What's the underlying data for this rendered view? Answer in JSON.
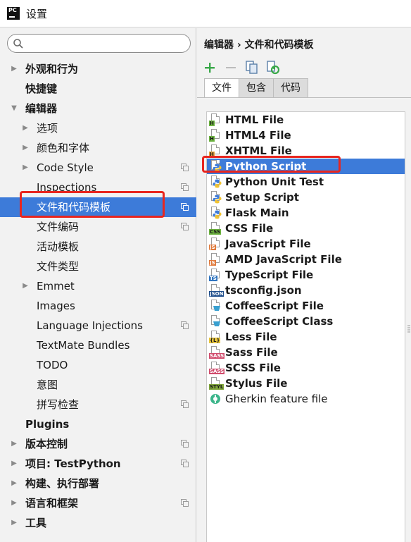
{
  "window": {
    "logo_text": "PC",
    "title": "设置"
  },
  "search": {
    "value": "",
    "placeholder": ""
  },
  "sidebar": {
    "items": [
      {
        "label": "外观和行为",
        "level": 0,
        "arrow": "▶",
        "bold": true,
        "copy": false,
        "selected": false
      },
      {
        "label": "快捷键",
        "level": 0,
        "arrow": "",
        "bold": true,
        "copy": false,
        "selected": false
      },
      {
        "label": "编辑器",
        "level": 0,
        "arrow": "▼",
        "bold": true,
        "copy": false,
        "selected": false
      },
      {
        "label": "选项",
        "level": 1,
        "arrow": "▶",
        "bold": false,
        "copy": false,
        "selected": false
      },
      {
        "label": "颜色和字体",
        "level": 1,
        "arrow": "▶",
        "bold": false,
        "copy": false,
        "selected": false
      },
      {
        "label": "Code Style",
        "level": 1,
        "arrow": "▶",
        "bold": false,
        "copy": true,
        "selected": false
      },
      {
        "label": "Inspections",
        "level": 1,
        "arrow": "",
        "bold": false,
        "copy": true,
        "selected": false
      },
      {
        "label": "文件和代码模板",
        "level": 1,
        "arrow": "",
        "bold": false,
        "copy": true,
        "selected": true
      },
      {
        "label": "文件编码",
        "level": 1,
        "arrow": "",
        "bold": false,
        "copy": true,
        "selected": false
      },
      {
        "label": "活动模板",
        "level": 1,
        "arrow": "",
        "bold": false,
        "copy": false,
        "selected": false
      },
      {
        "label": "文件类型",
        "level": 1,
        "arrow": "",
        "bold": false,
        "copy": false,
        "selected": false
      },
      {
        "label": "Emmet",
        "level": 1,
        "arrow": "▶",
        "bold": false,
        "copy": false,
        "selected": false
      },
      {
        "label": "Images",
        "level": 1,
        "arrow": "",
        "bold": false,
        "copy": false,
        "selected": false
      },
      {
        "label": "Language Injections",
        "level": 1,
        "arrow": "",
        "bold": false,
        "copy": true,
        "selected": false
      },
      {
        "label": "TextMate Bundles",
        "level": 1,
        "arrow": "",
        "bold": false,
        "copy": false,
        "selected": false
      },
      {
        "label": "TODO",
        "level": 1,
        "arrow": "",
        "bold": false,
        "copy": false,
        "selected": false
      },
      {
        "label": "意图",
        "level": 1,
        "arrow": "",
        "bold": false,
        "copy": false,
        "selected": false
      },
      {
        "label": "拼写检查",
        "level": 1,
        "arrow": "",
        "bold": false,
        "copy": true,
        "selected": false
      },
      {
        "label": "Plugins",
        "level": 0,
        "arrow": "",
        "bold": true,
        "copy": false,
        "selected": false
      },
      {
        "label": "版本控制",
        "level": 0,
        "arrow": "▶",
        "bold": true,
        "copy": true,
        "selected": false
      },
      {
        "label": "项目: TestPython",
        "level": 0,
        "arrow": "▶",
        "bold": true,
        "copy": true,
        "selected": false
      },
      {
        "label": "构建、执行部署",
        "level": 0,
        "arrow": "▶",
        "bold": true,
        "copy": false,
        "selected": false
      },
      {
        "label": "语言和框架",
        "level": 0,
        "arrow": "▶",
        "bold": true,
        "copy": true,
        "selected": false
      },
      {
        "label": "工具",
        "level": 0,
        "arrow": "▶",
        "bold": true,
        "copy": false,
        "selected": false
      }
    ]
  },
  "main": {
    "breadcrumb": "编辑器 › 文件和代码模板",
    "toolbar": [
      {
        "name": "add-icon"
      },
      {
        "name": "remove-icon"
      },
      {
        "name": "copy-template-icon"
      },
      {
        "name": "reset-icon"
      }
    ],
    "tabs": [
      {
        "label": "文件",
        "active": true
      },
      {
        "label": "包含",
        "active": false
      },
      {
        "label": "代码",
        "active": false
      }
    ],
    "templates": [
      {
        "name": "HTML File",
        "icon": "html-file-icon",
        "badge": "H",
        "badge_color": "#6cb33f",
        "bold": true,
        "selected": false
      },
      {
        "name": "HTML4 File",
        "icon": "html4-file-icon",
        "badge": "H",
        "badge_color": "#6cb33f",
        "bold": true,
        "selected": false
      },
      {
        "name": "XHTML File",
        "icon": "xhtml-file-icon",
        "badge": "H",
        "badge_color": "#e8a33d",
        "bold": true,
        "selected": false
      },
      {
        "name": "Python Script",
        "icon": "python-script-icon",
        "badge": "py",
        "badge_color": "#3d7bd9",
        "bold": true,
        "selected": true
      },
      {
        "name": "Python Unit Test",
        "icon": "python-unit-test-icon",
        "badge": "py",
        "badge_color": "#3d7bd9",
        "bold": true,
        "selected": false
      },
      {
        "name": "Setup Script",
        "icon": "setup-script-icon",
        "badge": "py",
        "badge_color": "#3d7bd9",
        "bold": true,
        "selected": false
      },
      {
        "name": "Flask Main",
        "icon": "flask-main-icon",
        "badge": "py",
        "badge_color": "#3d7bd9",
        "bold": true,
        "selected": false
      },
      {
        "name": "CSS File",
        "icon": "css-file-icon",
        "badge": "CSS",
        "badge_color": "#6cb33f",
        "bold": true,
        "selected": false
      },
      {
        "name": "JavaScript File",
        "icon": "javascript-file-icon",
        "badge": "JS",
        "badge_color": "#e07a3c",
        "bold": true,
        "selected": false
      },
      {
        "name": "AMD JavaScript File",
        "icon": "amd-javascript-file-icon",
        "badge": "JS",
        "badge_color": "#e07a3c",
        "bold": true,
        "selected": false
      },
      {
        "name": "TypeScript File",
        "icon": "typescript-file-icon",
        "badge": "TS",
        "badge_color": "#2f74c0",
        "bold": true,
        "selected": false
      },
      {
        "name": "tsconfig.json",
        "icon": "json-file-icon",
        "badge": "JSON",
        "badge_color": "#1f4e8c",
        "bold": true,
        "selected": false
      },
      {
        "name": "CoffeeScript File",
        "icon": "coffeescript-file-icon",
        "badge": "",
        "badge_color": "#3aa0d0",
        "bold": true,
        "selected": false
      },
      {
        "name": "CoffeeScript Class",
        "icon": "coffeescript-class-icon",
        "badge": "",
        "badge_color": "#3aa0d0",
        "bold": true,
        "selected": false
      },
      {
        "name": "Less File",
        "icon": "less-file-icon",
        "badge": "{L}",
        "badge_color": "#e8c53d",
        "bold": true,
        "selected": false
      },
      {
        "name": "Sass File",
        "icon": "sass-file-icon",
        "badge": "SASS",
        "badge_color": "#d04b6c",
        "bold": true,
        "selected": false
      },
      {
        "name": "SCSS File",
        "icon": "scss-file-icon",
        "badge": "SASS",
        "badge_color": "#d04b6c",
        "bold": true,
        "selected": false
      },
      {
        "name": "Stylus File",
        "icon": "stylus-file-icon",
        "badge": "STYL",
        "badge_color": "#7fa43a",
        "bold": true,
        "selected": false
      },
      {
        "name": "Gherkin feature file",
        "icon": "gherkin-file-icon",
        "badge": "",
        "badge_color": "#3bb58a",
        "bold": false,
        "selected": false
      }
    ]
  },
  "colors": {
    "selection": "#3d7bd9",
    "annotation": "#e8261f",
    "panel_bg": "#f2f2f2"
  }
}
